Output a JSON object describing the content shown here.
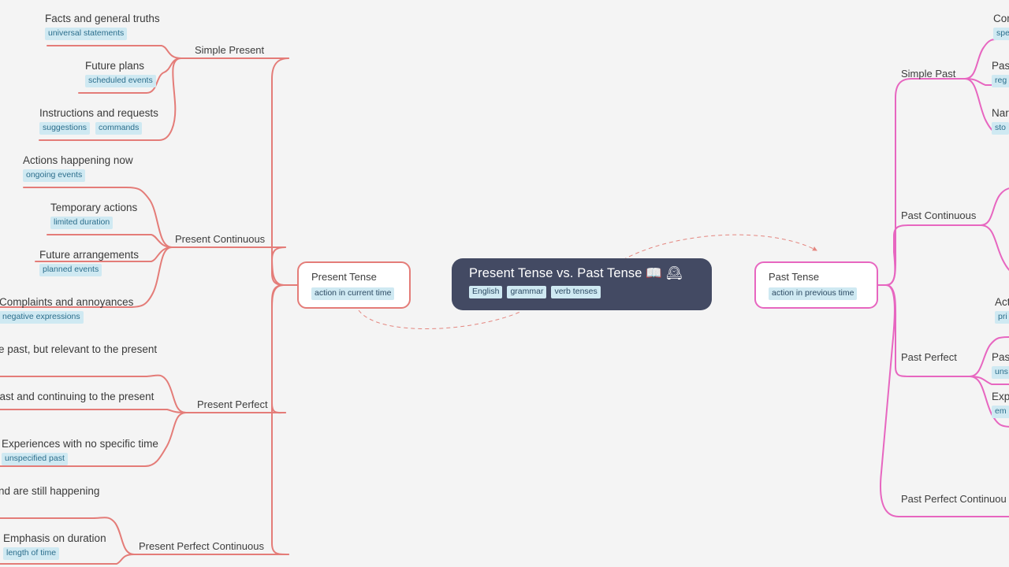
{
  "meta": {
    "background_color": "#f4f4f4",
    "root_color": "#434a63",
    "left_branch_color": "#e47c78",
    "right_branch_color": "#e766c0",
    "tag_bg_color": "#cfe9f2",
    "tag_text_color": "#2c6e8c",
    "text_color": "#3d3d3d"
  },
  "root": {
    "title": "Present Tense vs. Past Tense 📖 🕰",
    "tags": [
      "English",
      "grammar",
      "verb tenses"
    ]
  },
  "left_branch": {
    "title": "Present Tense",
    "tag": "action in current time",
    "children": [
      {
        "label": "Simple Present",
        "items": [
          {
            "title": "Facts and general truths",
            "tags": [
              "universal statements"
            ]
          },
          {
            "title": "Future plans",
            "tags": [
              "scheduled events"
            ]
          },
          {
            "title": "Instructions and requests",
            "tags": [
              "suggestions",
              "commands"
            ]
          }
        ]
      },
      {
        "label": "Present Continuous",
        "items": [
          {
            "title": "Actions happening now",
            "tags": [
              "ongoing events"
            ]
          },
          {
            "title": "Temporary actions",
            "tags": [
              "limited duration"
            ]
          },
          {
            "title": "Future arrangements",
            "tags": [
              "planned events"
            ]
          },
          {
            "title": "Complaints and annoyances",
            "tags": [
              "negative expressions"
            ]
          }
        ]
      },
      {
        "label": "Present Perfect",
        "items": [
          {
            "title": "e past, but relevant to the present",
            "tags": []
          },
          {
            "title": "past and continuing to the present",
            "tags": []
          },
          {
            "title": "Experiences with no specific time",
            "tags": [
              "unspecified past"
            ]
          }
        ]
      },
      {
        "label": "Present Perfect Continuous",
        "items": [
          {
            "title": "nd are still happening",
            "tags": []
          },
          {
            "title": "Emphasis on duration",
            "tags": [
              "length of time"
            ]
          }
        ]
      }
    ]
  },
  "right_branch": {
    "title": "Past Tense",
    "tag": "action in previous time",
    "children": [
      {
        "label": "Simple Past",
        "items": [
          {
            "title": "Com",
            "tags": [
              "spe"
            ]
          },
          {
            "title": "Pas",
            "tags": [
              "reg"
            ]
          },
          {
            "title": "Nar",
            "tags": [
              "sto"
            ]
          }
        ]
      },
      {
        "label": "Past Continuous",
        "items": []
      },
      {
        "label": "Past Perfect",
        "items": [
          {
            "title": "Act",
            "tags": [
              "pri"
            ]
          },
          {
            "title": "Pas",
            "tags": [
              "uns"
            ]
          },
          {
            "title": "Exp",
            "tags": [
              "em"
            ]
          }
        ]
      },
      {
        "label": "Past Perfect Continuou",
        "items": []
      }
    ]
  }
}
